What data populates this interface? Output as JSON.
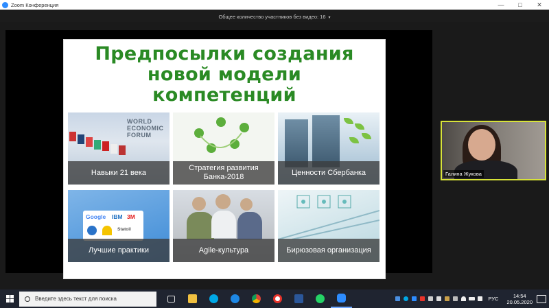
{
  "window": {
    "title": "Zoom Конференция",
    "minimize_glyph": "—",
    "maximize_glyph": "□",
    "close_glyph": "✕"
  },
  "meeting": {
    "participants_text": "Общее количество участников без видео: 16",
    "chevron_glyph": "▾"
  },
  "slide": {
    "title_line1": "Предпосылки создания",
    "title_line2": "новой модели",
    "title_line3": "компетенций",
    "title_color": "#2a8a24",
    "tiles": [
      {
        "caption": "Навыки 21 века",
        "logo_line1": "WORLD",
        "logo_line2": "ECONOMIC",
        "logo_line3": "FORUM"
      },
      {
        "caption": "Стратегия развития Банка-2018"
      },
      {
        "caption": "Ценности Сбербанка"
      },
      {
        "caption": "Лучшие практики",
        "logos": [
          "Google",
          "IBM",
          "3M",
          "Statoil"
        ]
      },
      {
        "caption": "Agile-культура"
      },
      {
        "caption": "Бирюзовая организация"
      }
    ]
  },
  "self_view": {
    "name": "Галина Жукова",
    "border_color": "#d8e339"
  },
  "taskbar": {
    "search_placeholder": "Введите здесь текст для поиска",
    "language": "РУС",
    "time": "14:54",
    "date": "20.05.2020"
  }
}
